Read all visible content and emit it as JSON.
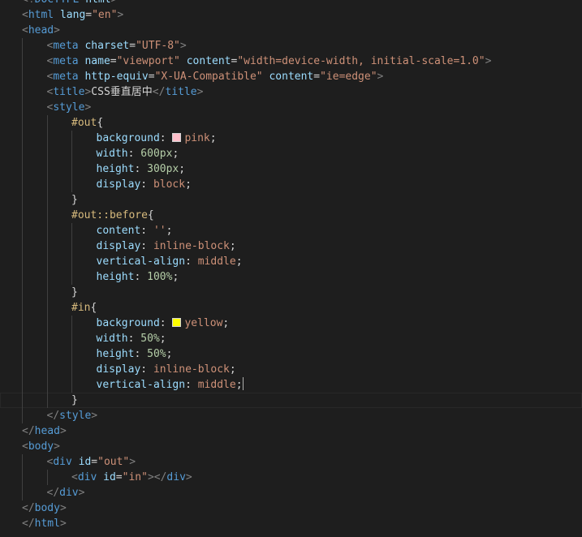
{
  "editor": {
    "language": "html",
    "cursor_line": 26,
    "colors": {
      "background": "#1e1e1e",
      "tag": "#569cd6",
      "attribute": "#9cdcfe",
      "string": "#ce9178",
      "selector": "#d7ba7d",
      "number": "#b5cea8",
      "bracket": "#808080",
      "swatch_pink": "#ffc0cb",
      "swatch_yellow": "#ffff00"
    },
    "lines": [
      {
        "indent": 0,
        "tokens": [
          [
            "bracket",
            "<!"
          ],
          [
            "tag",
            "DOCTYPE"
          ],
          [
            "text",
            " "
          ],
          [
            "attr",
            "html"
          ],
          [
            "bracket",
            ">"
          ]
        ]
      },
      {
        "indent": 0,
        "tokens": [
          [
            "bracket",
            "<"
          ],
          [
            "tag",
            "html"
          ],
          [
            "text",
            " "
          ],
          [
            "attr",
            "lang"
          ],
          [
            "text",
            "="
          ],
          [
            "str",
            "\"en\""
          ],
          [
            "bracket",
            ">"
          ]
        ]
      },
      {
        "indent": 0,
        "tokens": [
          [
            "bracket",
            "<"
          ],
          [
            "tag",
            "head"
          ],
          [
            "bracket",
            ">"
          ]
        ]
      },
      {
        "indent": 1,
        "tokens": [
          [
            "bracket",
            "<"
          ],
          [
            "tag",
            "meta"
          ],
          [
            "text",
            " "
          ],
          [
            "attr",
            "charset"
          ],
          [
            "text",
            "="
          ],
          [
            "str",
            "\"UTF-8\""
          ],
          [
            "bracket",
            ">"
          ]
        ]
      },
      {
        "indent": 1,
        "tokens": [
          [
            "bracket",
            "<"
          ],
          [
            "tag",
            "meta"
          ],
          [
            "text",
            " "
          ],
          [
            "attr",
            "name"
          ],
          [
            "text",
            "="
          ],
          [
            "str",
            "\"viewport\""
          ],
          [
            "text",
            " "
          ],
          [
            "attr",
            "content"
          ],
          [
            "text",
            "="
          ],
          [
            "str",
            "\"width=device-width, initial-scale=1.0\""
          ],
          [
            "bracket",
            ">"
          ]
        ]
      },
      {
        "indent": 1,
        "tokens": [
          [
            "bracket",
            "<"
          ],
          [
            "tag",
            "meta"
          ],
          [
            "text",
            " "
          ],
          [
            "attr",
            "http-equiv"
          ],
          [
            "text",
            "="
          ],
          [
            "str",
            "\"X-UA-Compatible\""
          ],
          [
            "text",
            " "
          ],
          [
            "attr",
            "content"
          ],
          [
            "text",
            "="
          ],
          [
            "str",
            "\"ie=edge\""
          ],
          [
            "bracket",
            ">"
          ]
        ]
      },
      {
        "indent": 1,
        "tokens": [
          [
            "bracket",
            "<"
          ],
          [
            "tag",
            "title"
          ],
          [
            "bracket",
            ">"
          ],
          [
            "text",
            "CSS垂直居中"
          ],
          [
            "bracket",
            "</"
          ],
          [
            "tag",
            "title"
          ],
          [
            "bracket",
            ">"
          ]
        ]
      },
      {
        "indent": 1,
        "tokens": [
          [
            "bracket",
            "<"
          ],
          [
            "tag",
            "style"
          ],
          [
            "bracket",
            ">"
          ]
        ]
      },
      {
        "indent": 2,
        "tokens": [
          [
            "sel",
            "#out"
          ],
          [
            "punc",
            "{"
          ]
        ]
      },
      {
        "indent": 3,
        "tokens": [
          [
            "prop",
            "background"
          ],
          [
            "punc",
            ": "
          ],
          [
            "swatch",
            "pink"
          ],
          [
            "val",
            "pink"
          ],
          [
            "punc",
            ";"
          ]
        ]
      },
      {
        "indent": 3,
        "tokens": [
          [
            "prop",
            "width"
          ],
          [
            "punc",
            ": "
          ],
          [
            "num",
            "600px"
          ],
          [
            "punc",
            ";"
          ]
        ]
      },
      {
        "indent": 3,
        "tokens": [
          [
            "prop",
            "height"
          ],
          [
            "punc",
            ": "
          ],
          [
            "num",
            "300px"
          ],
          [
            "punc",
            ";"
          ]
        ]
      },
      {
        "indent": 3,
        "tokens": [
          [
            "prop",
            "display"
          ],
          [
            "punc",
            ": "
          ],
          [
            "val",
            "block"
          ],
          [
            "punc",
            ";"
          ]
        ]
      },
      {
        "indent": 2,
        "tokens": [
          [
            "punc",
            "}"
          ]
        ]
      },
      {
        "indent": 2,
        "tokens": [
          [
            "sel",
            "#out::before"
          ],
          [
            "punc",
            "{"
          ]
        ]
      },
      {
        "indent": 3,
        "tokens": [
          [
            "prop",
            "content"
          ],
          [
            "punc",
            ": "
          ],
          [
            "val",
            "''"
          ],
          [
            "punc",
            ";"
          ]
        ]
      },
      {
        "indent": 3,
        "tokens": [
          [
            "prop",
            "display"
          ],
          [
            "punc",
            ": "
          ],
          [
            "val",
            "inline-block"
          ],
          [
            "punc",
            ";"
          ]
        ]
      },
      {
        "indent": 3,
        "tokens": [
          [
            "prop",
            "vertical-align"
          ],
          [
            "punc",
            ": "
          ],
          [
            "val",
            "middle"
          ],
          [
            "punc",
            ";"
          ]
        ]
      },
      {
        "indent": 3,
        "tokens": [
          [
            "prop",
            "height"
          ],
          [
            "punc",
            ": "
          ],
          [
            "num",
            "100%"
          ],
          [
            "punc",
            ";"
          ]
        ]
      },
      {
        "indent": 2,
        "tokens": [
          [
            "punc",
            "}"
          ]
        ]
      },
      {
        "indent": 2,
        "tokens": [
          [
            "sel",
            "#in"
          ],
          [
            "punc",
            "{"
          ]
        ]
      },
      {
        "indent": 3,
        "tokens": [
          [
            "prop",
            "background"
          ],
          [
            "punc",
            ": "
          ],
          [
            "swatch",
            "yellow"
          ],
          [
            "val",
            "yellow"
          ],
          [
            "punc",
            ";"
          ]
        ]
      },
      {
        "indent": 3,
        "tokens": [
          [
            "prop",
            "width"
          ],
          [
            "punc",
            ": "
          ],
          [
            "num",
            "50%"
          ],
          [
            "punc",
            ";"
          ]
        ]
      },
      {
        "indent": 3,
        "tokens": [
          [
            "prop",
            "height"
          ],
          [
            "punc",
            ": "
          ],
          [
            "num",
            "50%"
          ],
          [
            "punc",
            ";"
          ]
        ]
      },
      {
        "indent": 3,
        "tokens": [
          [
            "prop",
            "display"
          ],
          [
            "punc",
            ": "
          ],
          [
            "val",
            "inline-block"
          ],
          [
            "punc",
            ";"
          ]
        ]
      },
      {
        "indent": 3,
        "tokens": [
          [
            "prop",
            "vertical-align"
          ],
          [
            "punc",
            ": "
          ],
          [
            "val",
            "middle"
          ],
          [
            "punc",
            ";"
          ],
          [
            "cursor",
            ""
          ]
        ]
      },
      {
        "indent": 2,
        "tokens": [
          [
            "punc",
            "}"
          ]
        ]
      },
      {
        "indent": 1,
        "tokens": [
          [
            "bracket",
            "</"
          ],
          [
            "tag",
            "style"
          ],
          [
            "bracket",
            ">"
          ]
        ]
      },
      {
        "indent": 0,
        "tokens": [
          [
            "bracket",
            "</"
          ],
          [
            "tag",
            "head"
          ],
          [
            "bracket",
            ">"
          ]
        ]
      },
      {
        "indent": 0,
        "tokens": [
          [
            "bracket",
            "<"
          ],
          [
            "tag",
            "body"
          ],
          [
            "bracket",
            ">"
          ]
        ]
      },
      {
        "indent": 1,
        "tokens": [
          [
            "bracket",
            "<"
          ],
          [
            "tag",
            "div"
          ],
          [
            "text",
            " "
          ],
          [
            "attr",
            "id"
          ],
          [
            "text",
            "="
          ],
          [
            "str",
            "\"out\""
          ],
          [
            "bracket",
            ">"
          ]
        ]
      },
      {
        "indent": 2,
        "tokens": [
          [
            "bracket",
            "<"
          ],
          [
            "tag",
            "div"
          ],
          [
            "text",
            " "
          ],
          [
            "attr",
            "id"
          ],
          [
            "text",
            "="
          ],
          [
            "str",
            "\"in\""
          ],
          [
            "bracket",
            "></"
          ],
          [
            "tag",
            "div"
          ],
          [
            "bracket",
            ">"
          ]
        ]
      },
      {
        "indent": 1,
        "tokens": [
          [
            "bracket",
            "</"
          ],
          [
            "tag",
            "div"
          ],
          [
            "bracket",
            ">"
          ]
        ]
      },
      {
        "indent": 0,
        "tokens": [
          [
            "bracket",
            "</"
          ],
          [
            "tag",
            "body"
          ],
          [
            "bracket",
            ">"
          ]
        ]
      },
      {
        "indent": 0,
        "tokens": [
          [
            "bracket",
            "</"
          ],
          [
            "tag",
            "html"
          ],
          [
            "bracket",
            ">"
          ]
        ]
      }
    ]
  }
}
